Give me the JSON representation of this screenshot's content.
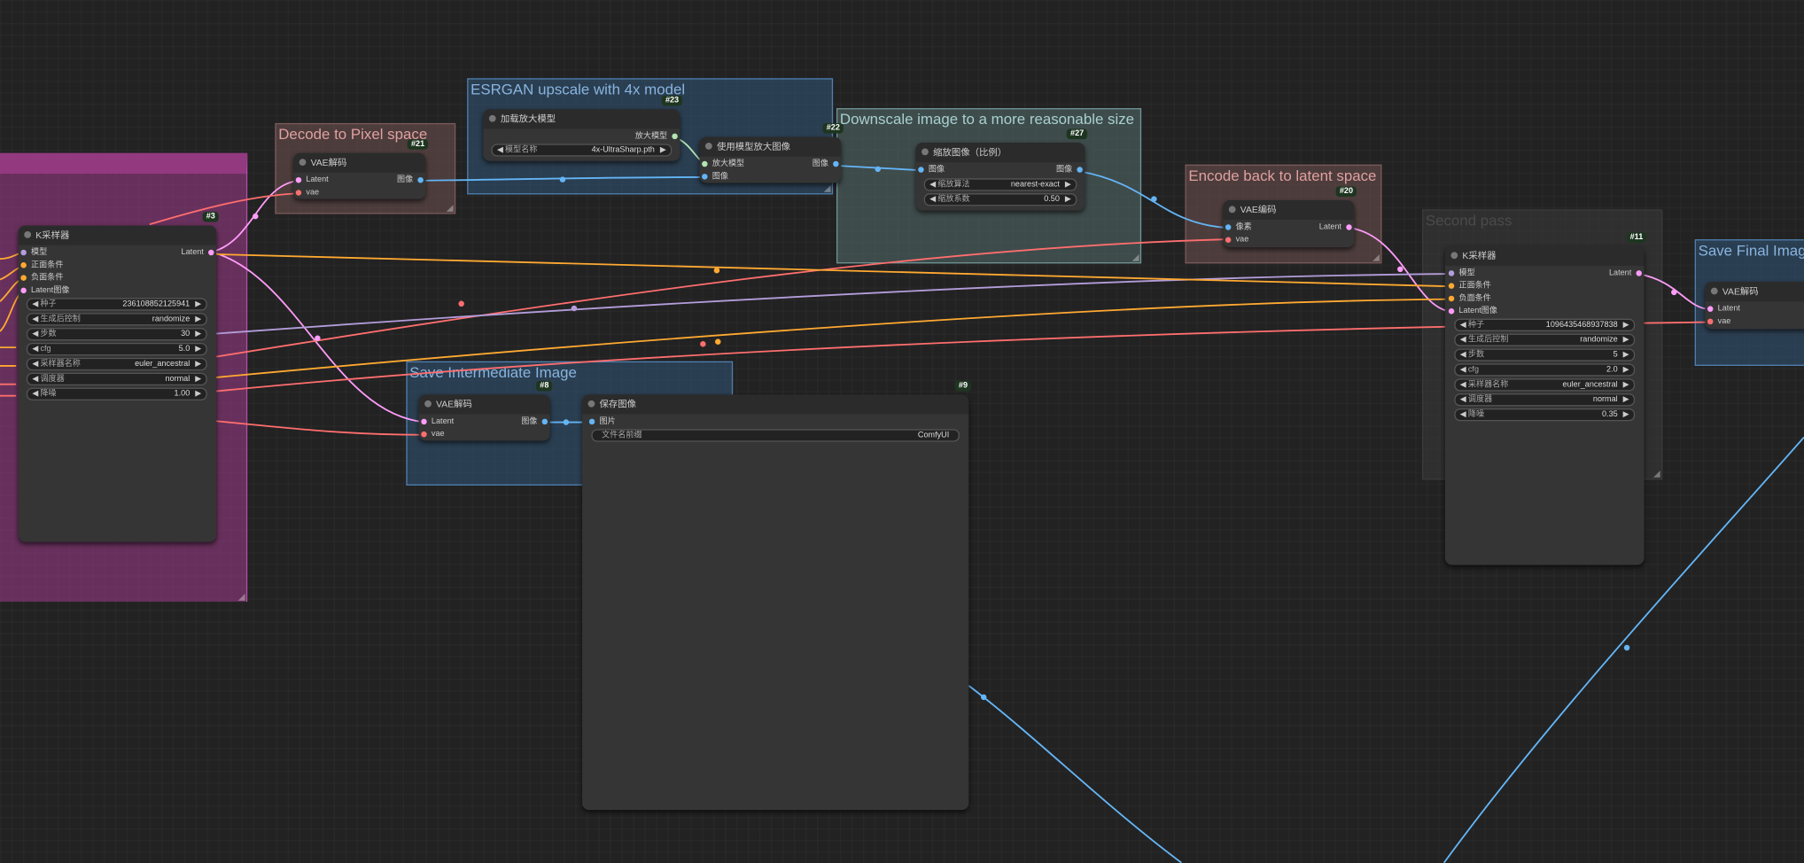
{
  "colors": {
    "latent": "#ff9cf9",
    "vae": "#ff6e6e",
    "image": "#64b5f6",
    "upscale_model": "#b3e5b3",
    "conditioning": "#ffa931",
    "model": "#b39ddb"
  },
  "groups": {
    "decode": "Decode to Pixel space",
    "esrgan": "ESRGAN upscale with 4x model",
    "downscale": "Downscale image to a more reasonable size",
    "encode": "Encode back to latent space",
    "second_pass": "Second pass",
    "save_final": "Save Final Image",
    "save_intermediate": "Save Intermediate Image"
  },
  "nodes": {
    "ksampler1": {
      "id": "#3",
      "title": "K采样器",
      "inputs": [
        "模型",
        "正面条件",
        "负面条件",
        "Latent图像"
      ],
      "output": "Latent",
      "widgets": [
        {
          "label": "种子",
          "value": "236108852125941"
        },
        {
          "label": "生成后控制",
          "value": "randomize"
        },
        {
          "label": "步数",
          "value": "30"
        },
        {
          "label": "cfg",
          "value": "5.0"
        },
        {
          "label": "采样器名称",
          "value": "euler_ancestral"
        },
        {
          "label": "调度器",
          "value": "normal"
        },
        {
          "label": "降噪",
          "value": "1.00"
        }
      ]
    },
    "vaedecode21": {
      "id": "#21",
      "title": "VAE解码",
      "inputs": [
        "Latent",
        "vae"
      ],
      "output": "图像"
    },
    "loadupscale": {
      "id": "#23",
      "title": "加载放大模型",
      "output": "放大模型",
      "widgets": [
        {
          "label": "模型名称",
          "value": "4x-UltraSharp.pth"
        }
      ]
    },
    "upscalewith": {
      "id": "#22",
      "title": "使用模型放大图像",
      "inputs": [
        "放大模型",
        "图像"
      ],
      "output": "图像"
    },
    "scaleby": {
      "id": "#27",
      "title": "缩放图像（比例）",
      "inputs": [
        "图像"
      ],
      "output": "图像",
      "widgets": [
        {
          "label": "缩放算法",
          "value": "nearest-exact"
        },
        {
          "label": "缩放系数",
          "value": "0.50"
        }
      ]
    },
    "vaeencode": {
      "id": "#20",
      "title": "VAE编码",
      "inputs": [
        "像素",
        "vae"
      ],
      "output": "Latent"
    },
    "ksampler2": {
      "id": "#11",
      "title": "K采样器",
      "inputs": [
        "模型",
        "正面条件",
        "负面条件",
        "Latent图像"
      ],
      "output": "Latent",
      "widgets": [
        {
          "label": "种子",
          "value": "1096435468937838"
        },
        {
          "label": "生成后控制",
          "value": "randomize"
        },
        {
          "label": "步数",
          "value": "5"
        },
        {
          "label": "cfg",
          "value": "2.0"
        },
        {
          "label": "采样器名称",
          "value": "euler_ancestral"
        },
        {
          "label": "调度器",
          "value": "normal"
        },
        {
          "label": "降噪",
          "value": "0.35"
        }
      ]
    },
    "vaedecode8": {
      "id": "#8",
      "title": "VAE解码",
      "inputs": [
        "Latent",
        "vae"
      ],
      "output": "图像"
    },
    "saveimage": {
      "id": "#9",
      "title": "保存图像",
      "inputs": [
        "图片"
      ],
      "widgets": [
        {
          "label": "文件名前缀",
          "value": "ComfyUI"
        }
      ]
    },
    "vaedecodefinal": {
      "title": "VAE解码",
      "inputs": [
        "Latent",
        "vae"
      ]
    }
  }
}
